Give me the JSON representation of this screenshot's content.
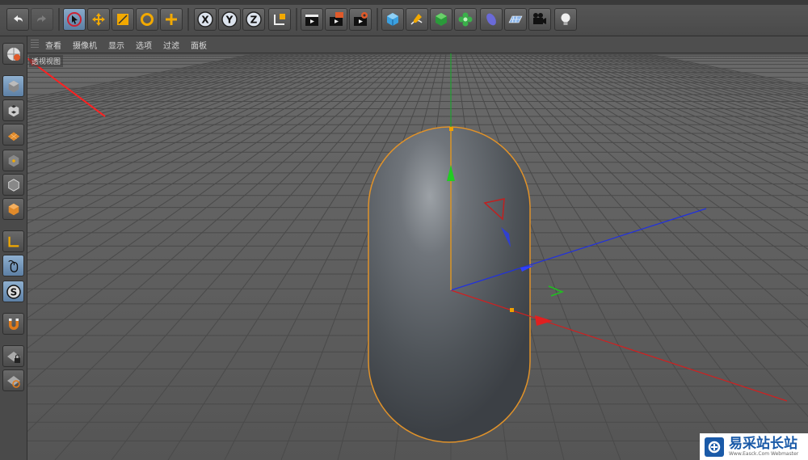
{
  "viewport_menu": [
    "查看",
    "摄像机",
    "显示",
    "选项",
    "过滤",
    "面板"
  ],
  "viewport_label": "透视视图",
  "toolbar": {
    "axis_x": "X",
    "axis_y": "Y",
    "axis_z": "Z"
  },
  "palette_s_label": "S",
  "watermark": {
    "title": "易采站长站",
    "subtitle": "Www.Easck.Com Webmaster"
  },
  "colors": {
    "object": "#62676d",
    "selection": "#e0922a",
    "axis_x": "#d02020",
    "axis_y": "#20c020",
    "axis_z": "#2030e0",
    "tool_active": "#6f92b8"
  }
}
